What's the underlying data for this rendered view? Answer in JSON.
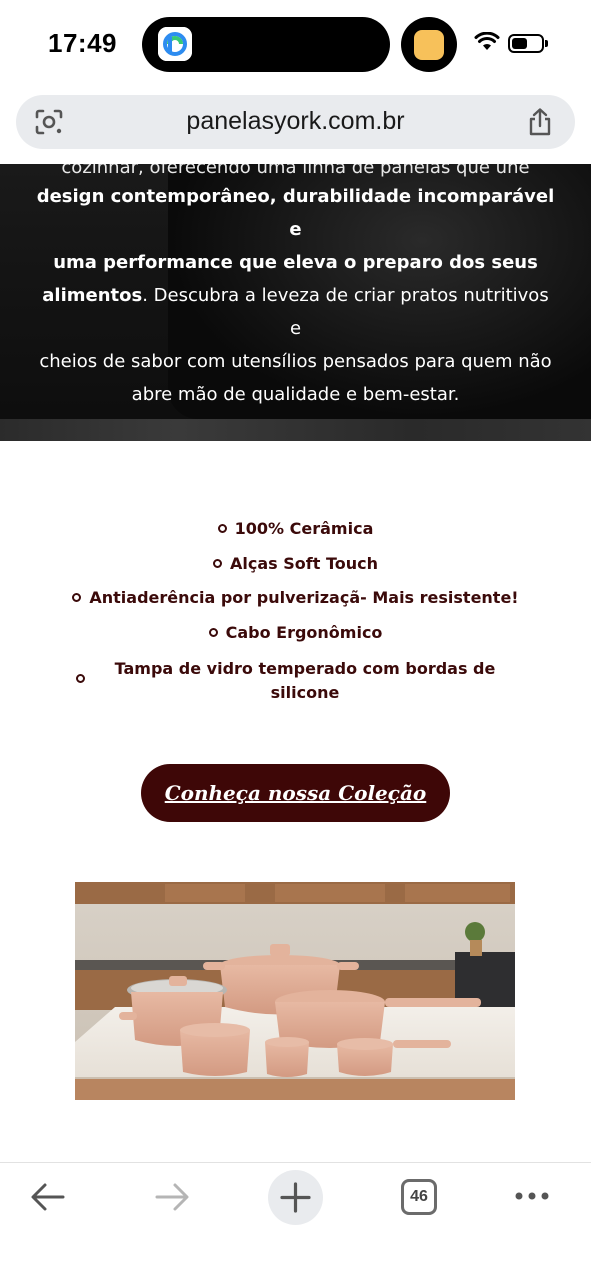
{
  "status_bar": {
    "time": "17:49"
  },
  "browser": {
    "url": "panelasyork.com.br",
    "tab_count": "46"
  },
  "hero": {
    "clipped_line": "cozinhar, oferecendo uma linha de panelas que une",
    "bold_lines": [
      "design contemporâneo, durabilidade incomparável e",
      "uma performance que eleva o preparo dos seus"
    ],
    "bold_word": "alimentos",
    "rest_line_1": ". Descubra a leveza de criar pratos nutritivos e",
    "rest_line_2": "cheios de sabor com utensílios pensados para quem não",
    "rest_line_3": "abre mão de qualidade e bem-estar."
  },
  "features": [
    "100% Cerâmica",
    "Alças Soft Touch",
    "Antiaderência por pulverizaçã- Mais resistente!",
    "Cabo Ergonômico",
    "Tampa de vidro temperado com bordas de silicone"
  ],
  "cta": {
    "label": "Conheça nossa Coleção"
  },
  "colors": {
    "brand": "#3e0707",
    "feature_text": "#3b0a0a",
    "hero_bg": "#0d0d0d"
  }
}
